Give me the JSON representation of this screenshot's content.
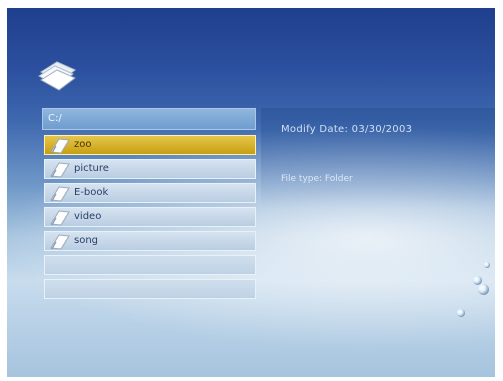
{
  "browser": {
    "path": "C:/",
    "items": [
      {
        "label": "zoo",
        "selected": true
      },
      {
        "label": "picture",
        "selected": false
      },
      {
        "label": "E-book",
        "selected": false
      },
      {
        "label": "video",
        "selected": false
      },
      {
        "label": "song",
        "selected": false
      }
    ],
    "empty_rows": 2
  },
  "info": {
    "modify_date": "Modify Date: 03/30/2003",
    "file_type": "File type: Folder"
  },
  "icons": {
    "header": "folder-stack-icon",
    "item": "page-icon",
    "decor": "bubble-icon"
  },
  "colors": {
    "selected": "#c9a21a",
    "background_top": "#1f3f8e",
    "background_bottom": "#a6c4de"
  }
}
